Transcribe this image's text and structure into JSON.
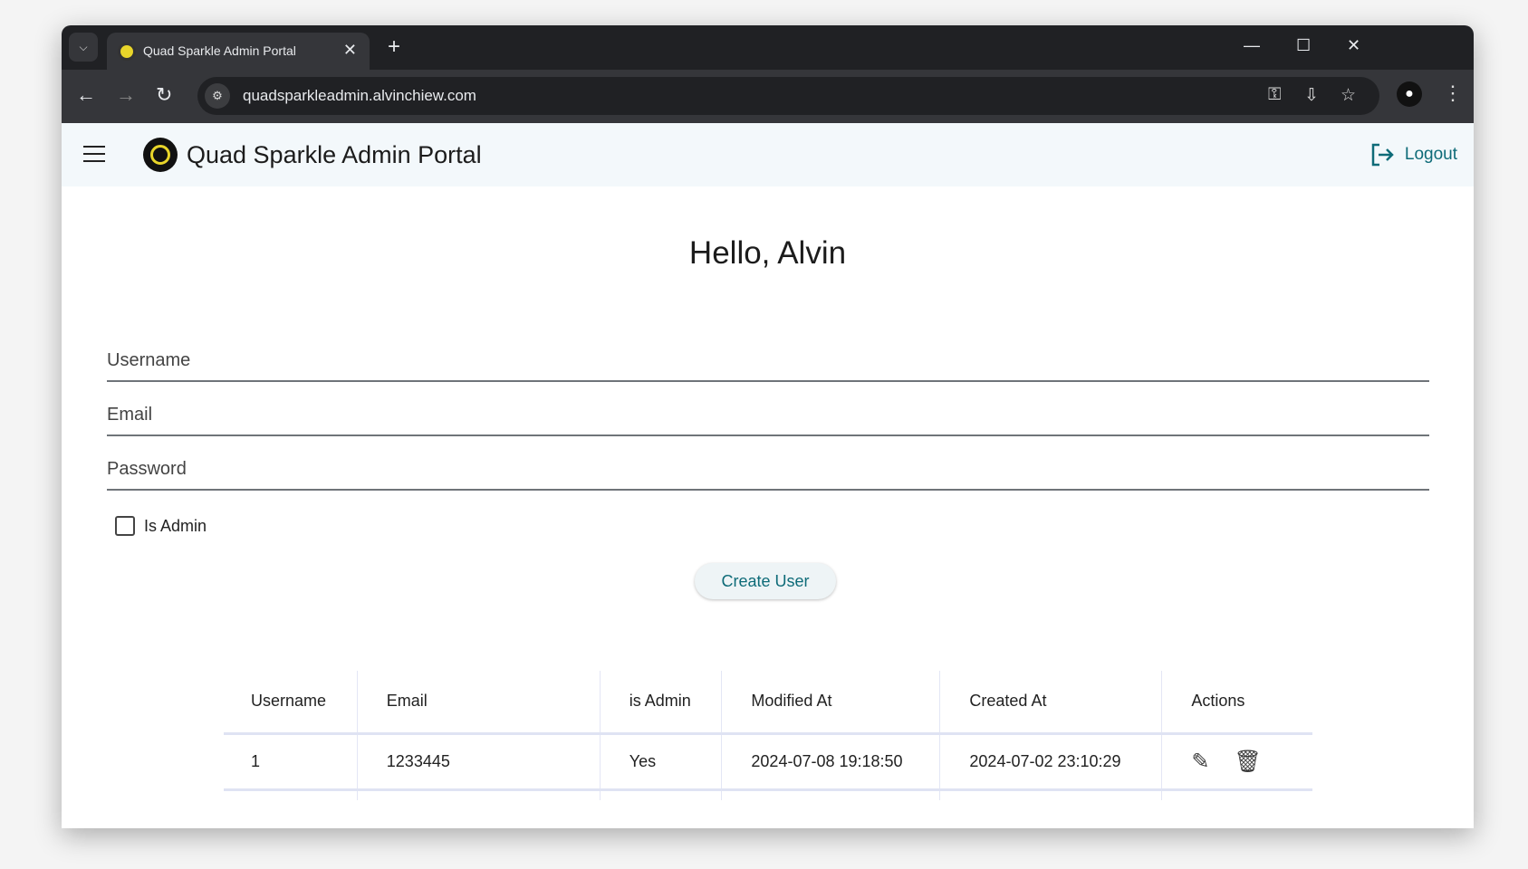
{
  "browser": {
    "tab_title": "Quad Sparkle Admin Portal",
    "url": "quadsparkleadmin.alvinchiew.com"
  },
  "header": {
    "title": "Quad Sparkle Admin Portal",
    "logout": "Logout"
  },
  "greeting": "Hello, Alvin",
  "form": {
    "username_placeholder": "Username",
    "email_placeholder": "Email",
    "password_placeholder": "Password",
    "is_admin_label": "Is Admin",
    "create_button": "Create User"
  },
  "table": {
    "columns": [
      "Username",
      "Email",
      "is Admin",
      "Modified At",
      "Created At",
      "Actions"
    ],
    "rows": [
      {
        "username": "1",
        "email": "1233445",
        "is_admin": "Yes",
        "modified_at": "2024-07-08 19:18:50",
        "created_at": "2024-07-02 23:10:29"
      }
    ]
  },
  "colors": {
    "accent": "#0e6b78",
    "header_bg": "#f3f8fb"
  }
}
